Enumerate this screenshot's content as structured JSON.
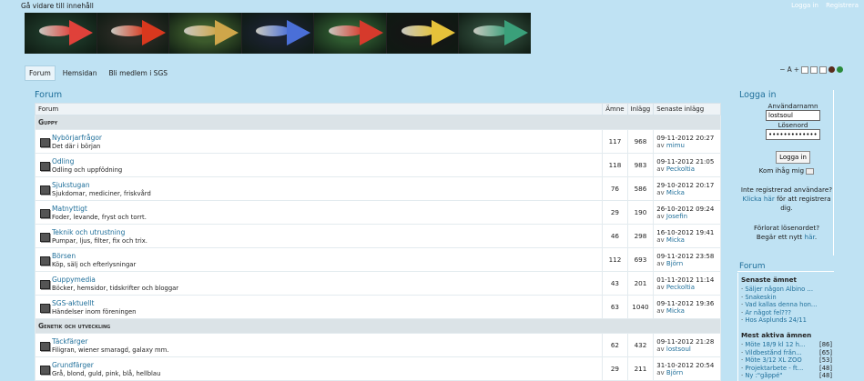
{
  "header": {
    "skip_link": "Gå vidare till innehåll",
    "top_links": [
      "Logga in",
      "Registrera"
    ]
  },
  "banner": {
    "fish_colors": [
      "#e0413a",
      "#d9381e",
      "#cfa64a",
      "#4a6fd8",
      "#d63a2c",
      "#e6c23a",
      "#3aa07a"
    ]
  },
  "tabs": [
    "Forum",
    "Hemsidan",
    "Bli medlem i SGS"
  ],
  "toolbar": {
    "font_small": "−",
    "font_a": "A",
    "font_large": "+"
  },
  "forum": {
    "title": "Forum",
    "columns": [
      "Forum",
      "Ämne",
      "Inlägg",
      "Senaste inlägg"
    ],
    "categories": [
      {
        "name": "Guppy",
        "forums": [
          {
            "name": "Nybörjarfrågor",
            "desc": "Det där i början",
            "topics": "117",
            "posts": "968",
            "last_date": "09-11-2012 20:27",
            "last_by": "mimu"
          },
          {
            "name": "Odling",
            "desc": "Odling och uppfödning",
            "topics": "118",
            "posts": "983",
            "last_date": "09-11-2012 21:05",
            "last_by": "Peckoltia"
          },
          {
            "name": "Sjukstugan",
            "desc": "Sjukdomar, mediciner, friskvård",
            "topics": "76",
            "posts": "586",
            "last_date": "29-10-2012 20:17",
            "last_by": "Micka"
          },
          {
            "name": "Matnyttigt",
            "desc": "Foder, levande, fryst och torrt.",
            "topics": "29",
            "posts": "190",
            "last_date": "26-10-2012 09:24",
            "last_by": "Josefin"
          },
          {
            "name": "Teknik och utrustning",
            "desc": "Pumpar, ljus, filter, fix och trix.",
            "topics": "46",
            "posts": "298",
            "last_date": "16-10-2012 19:41",
            "last_by": "Micka"
          },
          {
            "name": "Börsen",
            "desc": "Köp, sälj och efterlysningar",
            "topics": "112",
            "posts": "693",
            "last_date": "09-11-2012 23:58",
            "last_by": "Björn"
          },
          {
            "name": "Guppymedia",
            "desc": "Böcker, hemsidor, tidskrifter och bloggar",
            "topics": "43",
            "posts": "201",
            "last_date": "01-11-2012 11:14",
            "last_by": "Peckoltia"
          },
          {
            "name": "SGS-aktuellt",
            "desc": "Händelser inom föreningen",
            "topics": "63",
            "posts": "1040",
            "last_date": "09-11-2012 19:36",
            "last_by": "Micka"
          }
        ]
      },
      {
        "name": "Genetik och utveckling",
        "forums": [
          {
            "name": "Täckfärger",
            "desc": "Filigran, wiener smaragd, galaxy mm.",
            "topics": "62",
            "posts": "432",
            "last_date": "09-11-2012 21:28",
            "last_by": "lostsoul"
          },
          {
            "name": "Grundfärger",
            "desc": "Grå, blond, guld, pink, blå, hellblau",
            "topics": "29",
            "posts": "211",
            "last_date": "31-10-2012 20:54",
            "last_by": "Björn"
          }
        ]
      }
    ],
    "by_prefix": "av"
  },
  "login": {
    "title": "Logga in",
    "username_label": "Användarnamn",
    "username_value": "lostsoul",
    "password_label": "Lösenord",
    "password_value": "••••••••••••••",
    "button": "Logga in",
    "remember": "Kom ihåg mig",
    "not_registered": "Inte registrerad användare?",
    "click_here": "Klicka här",
    "to_register": "för att registrera dig.",
    "forgot": "Förlorat lösenordet?",
    "request_prefix": "Begär ett nytt",
    "here": "här"
  },
  "sidebar_forum": {
    "title": "Forum",
    "latest_title": "Senaste ämnet",
    "latest": [
      "Säljer någon Albino ...",
      "Snakeskin",
      "Vad kallas denna hon...",
      "Är något fel???",
      "Hos Asplunds 24/11"
    ],
    "active_title": "Mest aktiva ämnen",
    "active": [
      {
        "name": "Möte 18/9 kl 12 h...",
        "count": "[86]"
      },
      {
        "name": "Vildbestånd från...",
        "count": "[65]"
      },
      {
        "name": "Möte 3/12 XL ZOO",
        "count": "[53]"
      },
      {
        "name": "Projektarbete - ft...",
        "count": "[48]"
      },
      {
        "name": "Ny :\"gåppé\"",
        "count": "[48]"
      }
    ]
  }
}
